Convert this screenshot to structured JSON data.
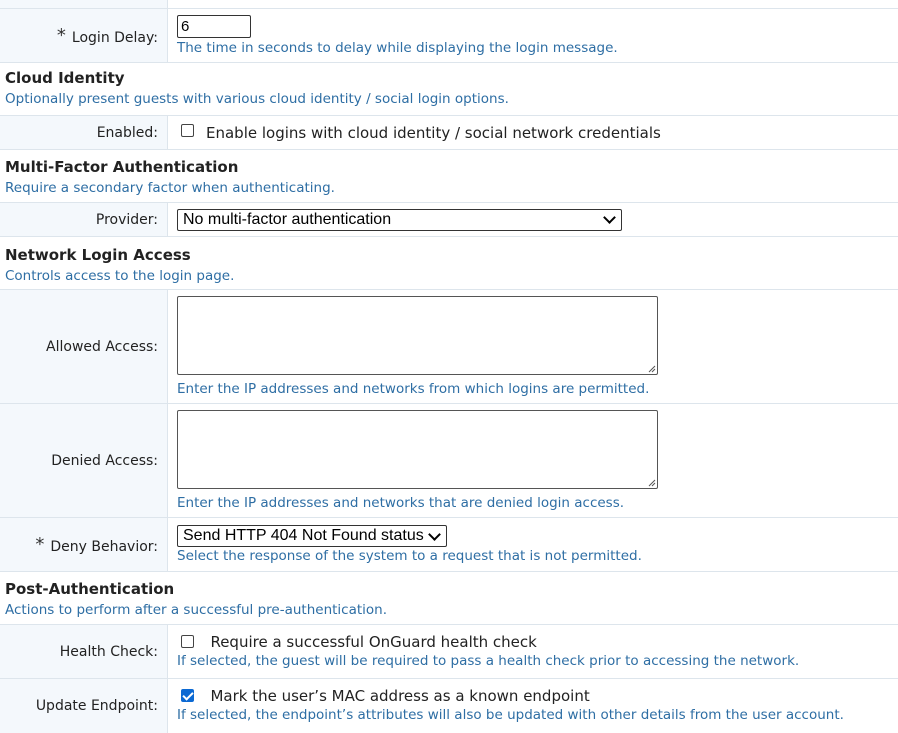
{
  "login_delay": {
    "label": "Login Delay:",
    "required_marker": "*",
    "value": "6",
    "help": "The time in seconds to delay while displaying the login message."
  },
  "cloud_identity": {
    "title": "Cloud Identity",
    "description": "Optionally present guests with various cloud identity / social login options.",
    "enabled": {
      "label": "Enabled:",
      "checkbox_text": "Enable logins with cloud identity / social network credentials",
      "checked": false
    }
  },
  "mfa": {
    "title": "Multi-Factor Authentication",
    "description": "Require a secondary factor when authenticating.",
    "provider": {
      "label": "Provider:",
      "selected": "No multi-factor authentication"
    }
  },
  "network_login": {
    "title": "Network Login Access",
    "description": "Controls access to the login page.",
    "allowed": {
      "label": "Allowed Access:",
      "value": "",
      "help": "Enter the IP addresses and networks from which logins are permitted."
    },
    "denied": {
      "label": "Denied Access:",
      "value": "",
      "help": "Enter the IP addresses and networks that are denied login access."
    },
    "deny_behavior": {
      "label": "Deny Behavior:",
      "required_marker": "*",
      "selected": "Send HTTP 404 Not Found status",
      "help": "Select the response of the system to a request that is not permitted."
    }
  },
  "post_auth": {
    "title": "Post-Authentication",
    "description": "Actions to perform after a successful pre-authentication.",
    "health_check": {
      "label": "Health Check:",
      "checkbox_text": "Require a successful OnGuard health check",
      "checked": false,
      "help": "If selected, the guest will be required to pass a health check prior to accessing the network."
    },
    "update_endpoint": {
      "label": "Update Endpoint:",
      "checkbox_text": "Mark the user’s MAC address as a known endpoint",
      "checked": true,
      "help": "If selected, the endpoint’s attributes will also be updated with other details from the user account."
    }
  },
  "colors": {
    "help_text": "#2e6ea4",
    "label_bg": "#f4f8fc",
    "checkbox_checked": "#0b69d3"
  }
}
